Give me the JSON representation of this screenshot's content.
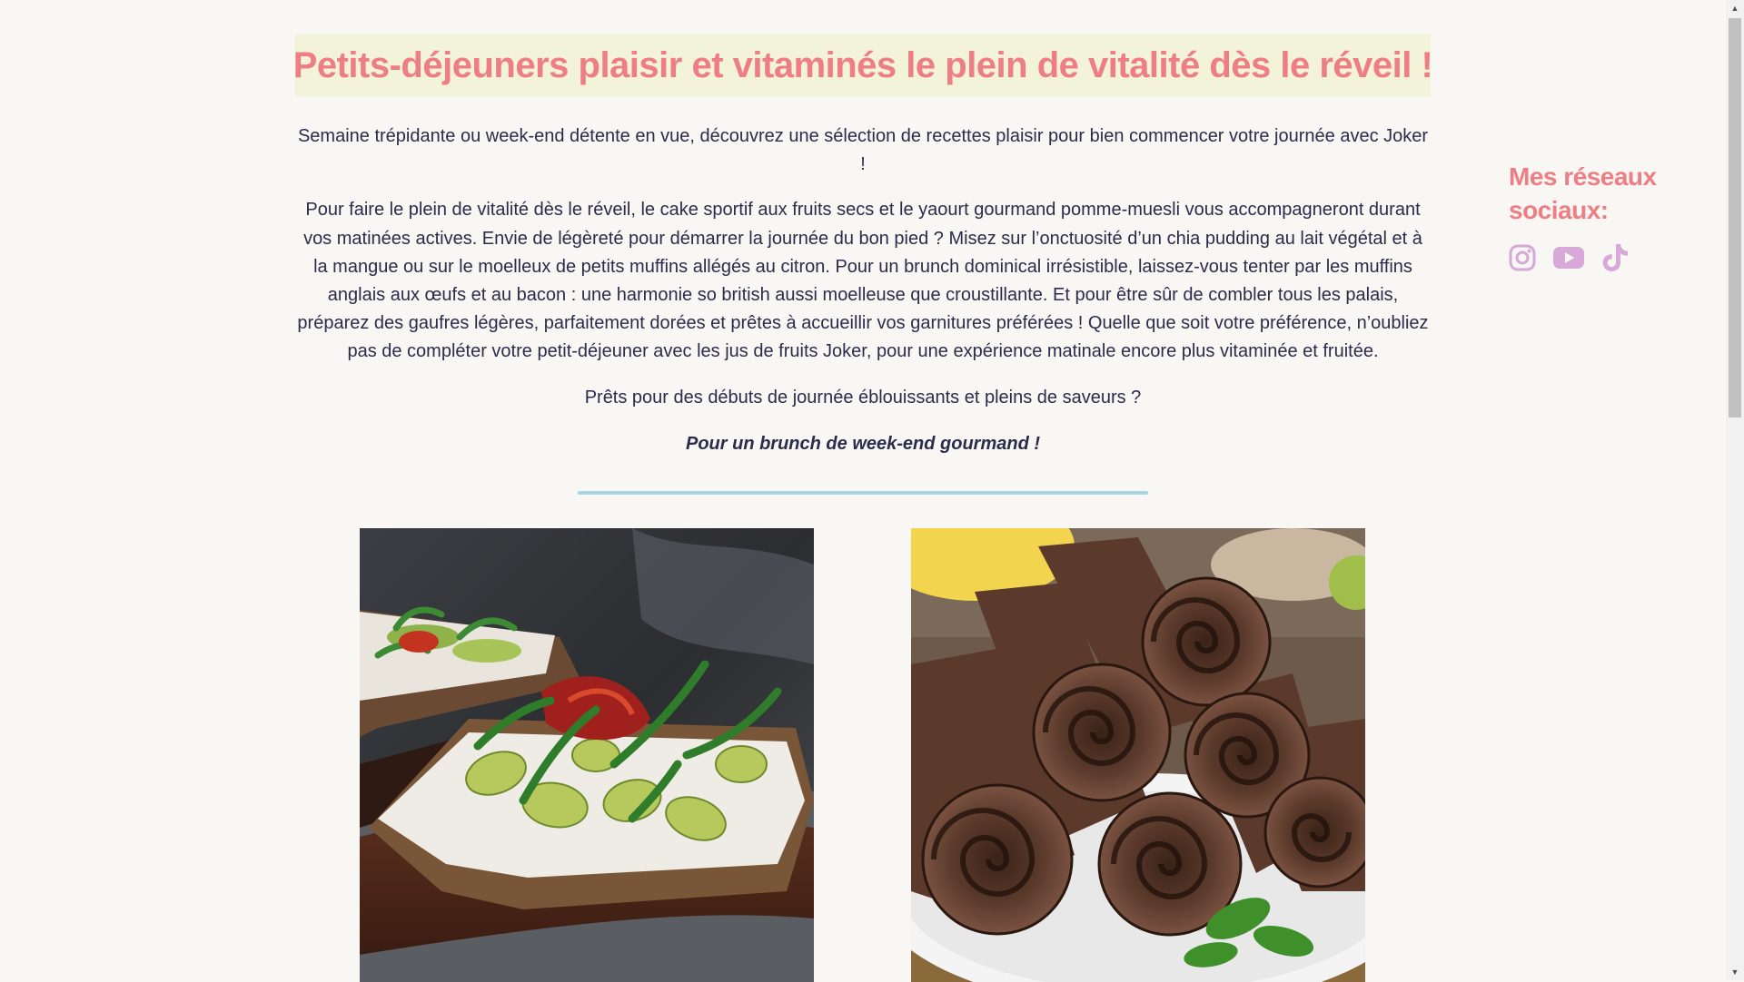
{
  "article": {
    "title": "Petits-déjeuners plaisir et vitaminés le plein de vitalité dès le réveil !",
    "intro": "Semaine trépidante ou week-end détente en vue, découvrez une sélection de recettes plaisir pour bien commencer votre journée avec Joker !",
    "body": "Pour faire le plein de vitalité dès le réveil, le cake sportif aux fruits secs et le yaourt gourmand pomme-muesli vous accompagneront durant vos matinées actives. Envie de légèreté pour démarrer la journée du bon pied ? Misez sur l’onctuosité d’un chia pudding au lait végétal et à la mangue ou sur le moelleux de petits muffins allégés au citron. Pour un brunch dominical irrésistible, laissez-vous tenter par les muffins anglais aux œufs et au bacon : une harmonie so british aussi moelleuse que croustillante. Et pour être sûr de combler tous les palais, préparez des gaufres légères, parfaitement dorées et prêtes à accueillir vos garnitures préférées ! Quelle que soit votre préférence, n’oubliez pas de compléter votre petit-déjeuner avec les jus de fruits Joker, pour une expérience matinale encore plus vitaminée et fruitée.",
    "ready": "Prêts pour des débuts de journée éblouissants et pleins de saveurs ?",
    "brunch": "Pour un brunch de week-end gourmand !"
  },
  "colors": {
    "title": "#ee7e84",
    "title_band": "#f3f3d9",
    "text": "#2b2c4b",
    "divider": "#a7d6e0",
    "social_icon": "#d7a8d8",
    "background": "#f8f7f4"
  },
  "photos": [
    {
      "subject": "avocado-toast"
    },
    {
      "subject": "rolled-chocolate-crepes"
    }
  ],
  "social": {
    "heading": "Mes réseaux sociaux:",
    "icons": [
      "instagram-icon",
      "youtube-icon",
      "tiktok-icon"
    ]
  }
}
